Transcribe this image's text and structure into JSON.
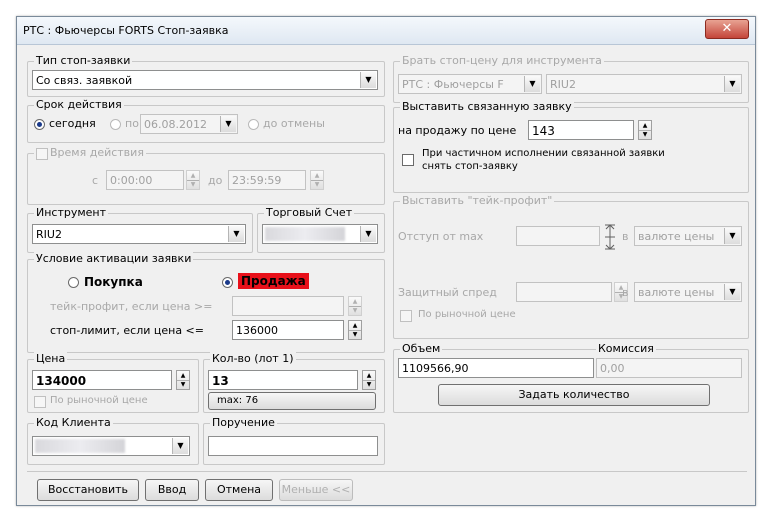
{
  "window": {
    "title": "РТС : Фьючерсы FORTS Стоп-заявка",
    "close": "✕"
  },
  "order_type": {
    "legend": "Тип стоп-заявки",
    "value": "Со связ. заявкой"
  },
  "validity": {
    "legend": "Срок действия",
    "today": "сегодня",
    "until": "по",
    "date": "06.08.2012",
    "until_cancel": "до отмены"
  },
  "active_time": {
    "legend": "Время действия",
    "from": "с",
    "from_value": "0:00:00",
    "to": "до",
    "to_value": "23:59:59"
  },
  "instrument": {
    "legend": "Инструмент",
    "value": "RIU2"
  },
  "account": {
    "legend": "Торговый Счет"
  },
  "activation": {
    "legend": "Условие активации заявки",
    "buy": "Покупка",
    "sell": "Продажа",
    "take_profit_label": "тейк-профит, если цена >=",
    "stop_limit_label": "стоп-лимит, если цена <=",
    "stop_limit_value": "136000"
  },
  "price": {
    "legend": "Цена",
    "value": "134000",
    "market_label": "По рыночной цене"
  },
  "qty": {
    "legend": "Кол-во (лот 1)",
    "value": "13",
    "max": "max: 76"
  },
  "client": {
    "legend": "Код Клиента"
  },
  "instruction": {
    "legend": "Поручение"
  },
  "take_price": {
    "legend": "Брать стоп-цену для инструмента",
    "class_value": "РТС : Фьючерсы F",
    "sec_value": "RIU2"
  },
  "linked": {
    "legend": "Выставить связанную заявку",
    "sell_label": "на продажу по цене",
    "price_value": "143",
    "cancel_label_1": "При частичном исполнении связанной заявки",
    "cancel_label_2": "снять стоп-заявку"
  },
  "take_profit": {
    "legend": "Выставить \"тейк-профит\"",
    "offset_label": "Отступ от max",
    "in_label": "в",
    "currency1": "валюте цены",
    "spread_label": "Защитный спред",
    "currency2": "валюте цены",
    "market_label": "По рыночной цене"
  },
  "volume": {
    "legend": "Объем",
    "value": "1109566,90",
    "commission_label": "Комиссия",
    "commission_value": "0,00",
    "set_qty": "Задать количество"
  },
  "footer": {
    "restore": "Восстановить",
    "enter": "Ввод",
    "cancel": "Отмена",
    "less": "Меньше <<"
  },
  "colors": {
    "sell_highlight": "#e8101a",
    "title_bar": "#dfe8f2",
    "close_button": "#c4453a"
  }
}
